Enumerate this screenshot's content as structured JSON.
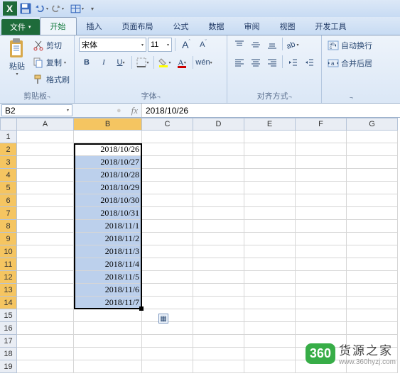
{
  "qat": {
    "excel": "X"
  },
  "tabs": {
    "file": "文件",
    "home": "开始",
    "insert": "插入",
    "pagelayout": "页面布局",
    "formulas": "公式",
    "data": "数据",
    "review": "审阅",
    "view": "视图",
    "dev": "开发工具"
  },
  "clipboard": {
    "paste": "粘贴",
    "cut": "剪切",
    "copy": "复制",
    "brush": "格式刷",
    "label": "剪贴板"
  },
  "font": {
    "name": "宋体",
    "size": "11",
    "label": "字体",
    "A_big": "A",
    "A_small": "A"
  },
  "align": {
    "label": "对齐方式"
  },
  "wrap": {
    "wrap": "自动换行",
    "merge": "合并后居",
    "label": ""
  },
  "namebox": "B2",
  "fx_label": "fx",
  "formula_value": "2018/10/26",
  "cols": [
    "A",
    "B",
    "C",
    "D",
    "E",
    "F",
    "G"
  ],
  "cells": {
    "b2": "2018/10/26",
    "b3": "2018/10/27",
    "b4": "2018/10/28",
    "b5": "2018/10/29",
    "b6": "2018/10/30",
    "b7": "2018/10/31",
    "b8": "2018/11/1",
    "b9": "2018/11/2",
    "b10": "2018/11/3",
    "b11": "2018/11/4",
    "b12": "2018/11/5",
    "b13": "2018/11/6",
    "b14": "2018/11/7"
  },
  "rows": [
    "1",
    "2",
    "3",
    "4",
    "5",
    "6",
    "7",
    "8",
    "9",
    "10",
    "11",
    "12",
    "13",
    "14",
    "15",
    "16",
    "17",
    "18",
    "19"
  ],
  "watermark": {
    "badge": "360",
    "title": "货源之家",
    "sub": "www.360hyzj.com"
  }
}
